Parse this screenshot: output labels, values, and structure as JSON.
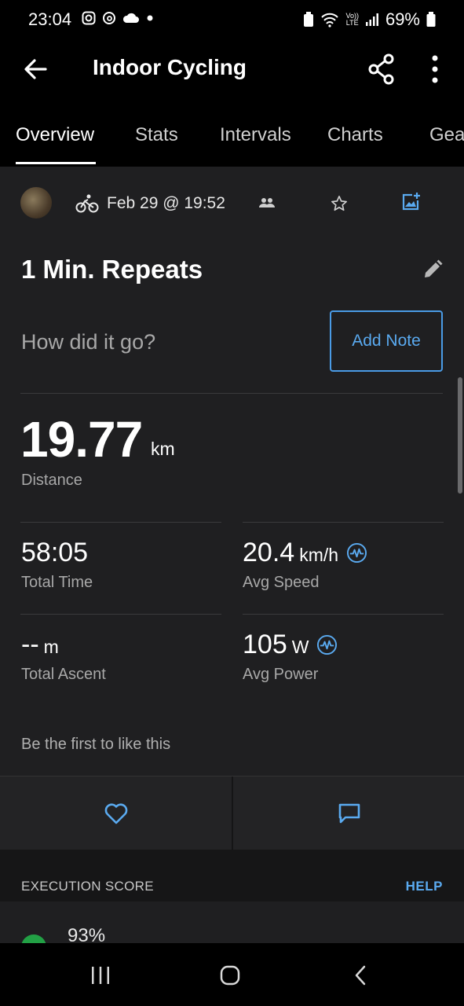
{
  "status_bar": {
    "time": "23:04",
    "battery": "69%",
    "network_top": "Vo))",
    "network_bottom": "LTE"
  },
  "app_bar": {
    "title": "Indoor Cycling",
    "back_icon": "arrow-left-icon",
    "share_icon": "share-icon",
    "more_icon": "more-vertical-icon"
  },
  "tabs": [
    {
      "label": "Overview",
      "active": true
    },
    {
      "label": "Stats",
      "active": false
    },
    {
      "label": "Intervals",
      "active": false
    },
    {
      "label": "Charts",
      "active": false
    },
    {
      "label": "Gea",
      "active": false
    }
  ],
  "activity": {
    "date": "Feb 29 @ 19:52",
    "name": "1 Min. Repeats",
    "how_prompt": "How did it go?",
    "add_note_label": "Add Note"
  },
  "distance": {
    "value": "19.77",
    "unit": "km",
    "label": "Distance"
  },
  "stats": [
    {
      "value": "58:05",
      "unit": "",
      "label": "Total Time"
    },
    {
      "value": "20.4",
      "unit": "km/h",
      "label": "Avg Speed"
    },
    {
      "value": "--",
      "unit": "m",
      "label": "Total Ascent"
    },
    {
      "value": "105",
      "unit": "W",
      "label": "Avg Power"
    }
  ],
  "social": {
    "likes_text": "Be the first to like this"
  },
  "execution": {
    "title": "EXECUTION SCORE",
    "help_label": "HELP",
    "score": "93%"
  },
  "colors": {
    "accent": "#4a9be6",
    "background": "#1f1f21",
    "score_green": "#22a045"
  }
}
